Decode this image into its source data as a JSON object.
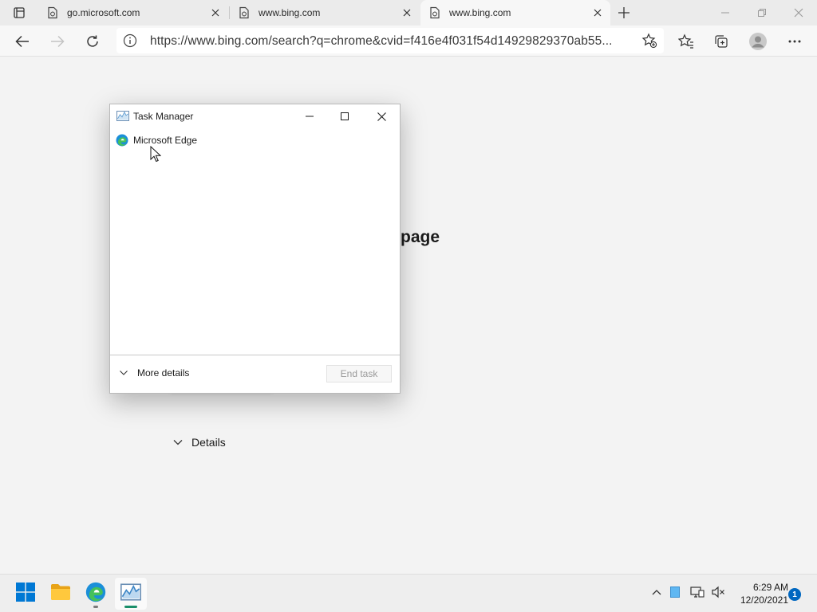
{
  "browser": {
    "tabs": [
      {
        "title": "go.microsoft.com",
        "active": false
      },
      {
        "title": "www.bing.com",
        "active": false
      },
      {
        "title": "www.bing.com",
        "active": true
      }
    ],
    "address_bar": {
      "url": "https://www.bing.com/search?q=chrome&cvid=f416e4f031f54d14929829370ab55..."
    }
  },
  "page": {
    "heading_fragment": "page",
    "details_label": "Details"
  },
  "task_manager": {
    "title": "Task Manager",
    "apps": [
      {
        "name": "Microsoft Edge",
        "icon": "edge-icon"
      }
    ],
    "more_details_label": "More details",
    "end_task_label": "End task",
    "end_task_enabled": false
  },
  "taskbar": {
    "apps": [
      "start-icon",
      "file-explorer-icon",
      "edge-icon",
      "task-manager-icon"
    ],
    "time": "6:29 AM",
    "date": "12/20/2021",
    "notification_count": "1"
  },
  "colors": {
    "accent": "#0067c0",
    "page_background": "#f3f3f3",
    "tabstrip_background": "#ebebeb"
  }
}
